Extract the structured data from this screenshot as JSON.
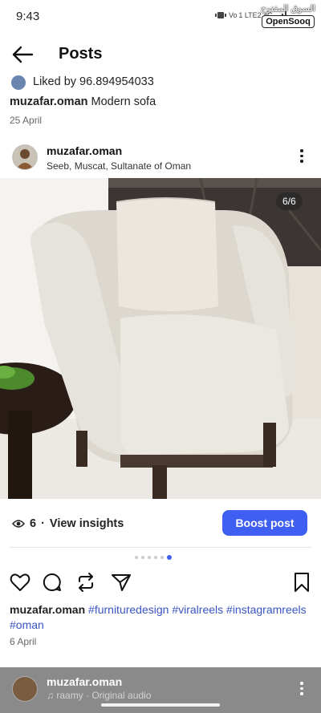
{
  "status": {
    "time": "9:43",
    "network": "Vo 1 LTE2 4G"
  },
  "watermark": {
    "arabic": "السوق المفتوح",
    "brand": "OpenSooq"
  },
  "header": {
    "title": "Posts"
  },
  "liked": {
    "text": "Liked by 96.894954033"
  },
  "caption_top": {
    "username": "muzafar.oman",
    "text": "Modern sofa"
  },
  "date_top": "25 April",
  "author": {
    "username": "muzafar.oman",
    "location": "Seeb, Muscat, Sultanate of Oman"
  },
  "media": {
    "counter": "6/6",
    "carousel_count": 6,
    "carousel_active": 6
  },
  "insights": {
    "count": "6",
    "label": "View insights"
  },
  "boost": {
    "label": "Boost post"
  },
  "caption_bottom": {
    "username": "muzafar.oman",
    "tags": [
      "#furnituredesign",
      "#viralreels",
      "#instagramreels",
      "#oman"
    ]
  },
  "date_bottom": "6 April",
  "next_post": {
    "username": "muzafar.oman",
    "audio": "raamy · Original audio"
  },
  "colors": {
    "accent": "#3f5ef2",
    "hashtag": "#3a54c4"
  },
  "icons": [
    "back-arrow-icon",
    "heart-icon",
    "comment-icon",
    "repost-icon",
    "share-icon",
    "bookmark-icon",
    "eye-icon",
    "more-icon",
    "music-note-icon"
  ]
}
